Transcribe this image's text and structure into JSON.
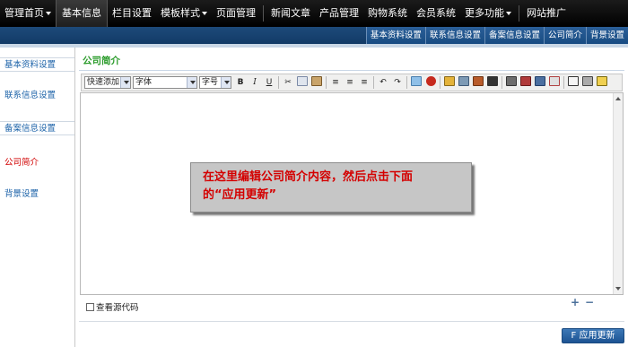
{
  "topnav": [
    {
      "label": "管理首页",
      "dropdown": true
    },
    {
      "label": "基本信息",
      "dropdown": false,
      "active": true
    },
    {
      "label": "栏目设置",
      "dropdown": false
    },
    {
      "label": "模板样式",
      "dropdown": true
    },
    {
      "label": "页面管理",
      "dropdown": false
    },
    {
      "label": "新闻文章",
      "dropdown": false
    },
    {
      "label": "产品管理",
      "dropdown": false
    },
    {
      "label": "购物系统",
      "dropdown": false
    },
    {
      "label": "会员系统",
      "dropdown": false
    },
    {
      "label": "更多功能",
      "dropdown": true
    },
    {
      "label": "网站推广",
      "dropdown": false
    }
  ],
  "subnav": [
    "基本资料设置",
    "联系信息设置",
    "备案信息设置",
    "公司简介",
    "背景设置"
  ],
  "sidebar": [
    "基本资料设置",
    "联系信息设置",
    "备案信息设置",
    "公司简介",
    "背景设置"
  ],
  "main": {
    "title": "公司简介",
    "callout_line1": "在这里编辑公司简介内容，然后点击下面",
    "callout_line2": "的“应用更新”",
    "view_source_label": "查看源代码",
    "apply_label": "F 应用更新"
  },
  "toolbar": {
    "quick_add": "快速添加",
    "font": "字体",
    "size": "字号"
  },
  "colors": {
    "title_green": "#2a9b2a",
    "active_red": "#d10000",
    "link_blue": "#1b62a8",
    "callout_red": "#d40000"
  }
}
